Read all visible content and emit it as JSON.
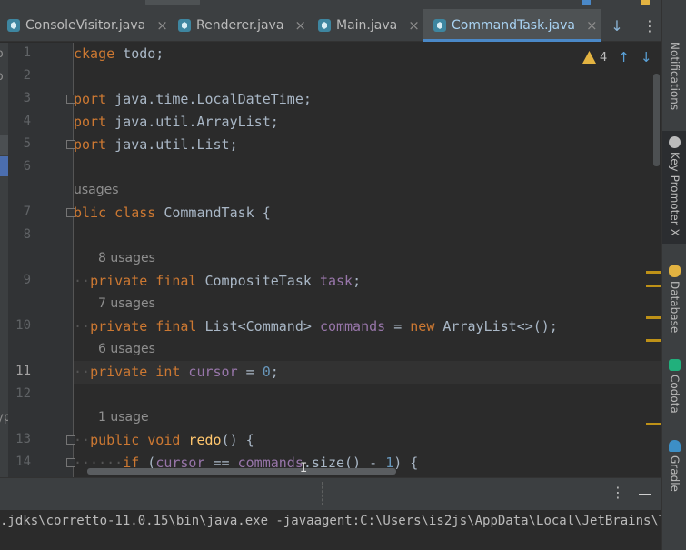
{
  "colors": {
    "keyword": "#cc7832",
    "field": "#9876aa",
    "number": "#6897bb",
    "method": "#ffc66d",
    "text": "#a9b7c6",
    "background": "#2b2b2b",
    "tab_active": "#a9d3f3",
    "warning": "#e3b341",
    "marker": "#be9117"
  },
  "tabs": [
    {
      "label": "ConsoleVisitor.java",
      "close": "×",
      "active": false,
      "icon": "java-class-icon"
    },
    {
      "label": "Renderer.java",
      "close": "×",
      "active": false,
      "icon": "java-class-icon"
    },
    {
      "label": "Main.java",
      "close": "×",
      "active": false,
      "icon": "java-class-icon"
    },
    {
      "label": "CommandTask.java",
      "close": "×",
      "active": true,
      "icon": "java-class-icon"
    }
  ],
  "tab_actions": {
    "more": "↓",
    "menu": "⋮"
  },
  "inspection": {
    "warnings": "4",
    "prev": "↑",
    "next": "↓"
  },
  "left_panel": {
    "fragments": [
      "o",
      "o",
      "yp"
    ]
  },
  "gutter": {
    "line_numbers": [
      "1",
      "2",
      "3",
      "4",
      "5",
      "6",
      "7",
      "8",
      "9",
      "10",
      "11",
      "12",
      "13",
      "14"
    ]
  },
  "code": {
    "l1": {
      "kw": "ckage",
      "rest": " todo;"
    },
    "l3": {
      "kw": "port",
      "rest": " java.time.LocalDateTime;"
    },
    "l4": {
      "kw": "port",
      "rest": " java.util.ArrayList;"
    },
    "l5": {
      "kw": "port",
      "rest": " java.util.List;"
    },
    "h7": "usages",
    "l7": {
      "kw": "blic class",
      "rest": " CommandTask {"
    },
    "h9": "8 usages",
    "l9": {
      "kw": "private final",
      "type": " CompositeTask ",
      "field": "task",
      "rest": ";"
    },
    "h10": "7 usages",
    "l10": {
      "kw": "private final",
      "type": " List<Command> ",
      "field": "commands",
      "op": " = ",
      "kw2": "new",
      "rest": " ArrayList<>();"
    },
    "h11": "6 usages",
    "l11": {
      "kw": "private int",
      "field": " cursor",
      "op": " = ",
      "num": "0",
      "rest": ";"
    },
    "h13": "1 usage",
    "l13": {
      "kw": "public void",
      "fn": " redo",
      "rest": "() {"
    },
    "l14": {
      "kw": "if",
      "open": " (",
      "field": "cursor",
      "op": " == ",
      "field2": "commands",
      "mid": ".size() - ",
      "num": "1",
      "rest": ") {"
    }
  },
  "right_tools": [
    {
      "label": "Notifications",
      "icon": "bell-icon"
    },
    {
      "label": "Key Promoter X",
      "icon": "key-promoter-icon"
    },
    {
      "label": "Database",
      "icon": "database-icon"
    },
    {
      "label": "Codota",
      "icon": "codota-icon"
    },
    {
      "label": "Gradle",
      "icon": "gradle-icon"
    }
  ],
  "run_panel": {
    "options": "⋮",
    "console_line": ".jdks\\corretto-11.0.15\\bin\\java.exe -javaagent:C:\\Users\\is2js\\AppData\\Local\\JetBrains\\Toolbo"
  }
}
